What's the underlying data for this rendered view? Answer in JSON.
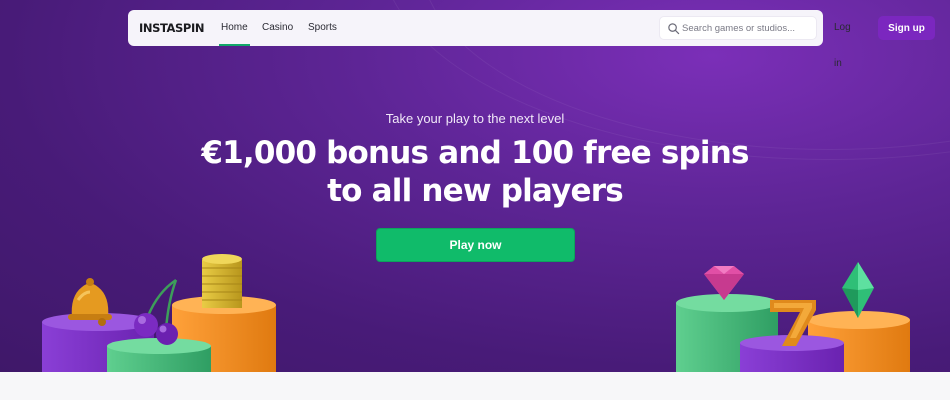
{
  "brand": {
    "logo_text": "INSTASPIN"
  },
  "nav": {
    "links": [
      {
        "label": "Home",
        "active": true
      },
      {
        "label": "Casino",
        "active": false
      },
      {
        "label": "Sports",
        "active": false
      }
    ],
    "search": {
      "placeholder": "Search games or studios...",
      "value": "",
      "icon": "search-icon"
    },
    "login_label": "Log in",
    "signup_label": "Sign up"
  },
  "hero": {
    "tagline": "Take your play to the next level",
    "headline": "€1,000 bonus and 100 free spins to all new players",
    "cta_label": "Play now",
    "decor_icons": [
      "bell-icon",
      "cherries-icon",
      "coin-stack-icon",
      "gem-icon",
      "lucky-seven-icon",
      "diamond-crystal-icon"
    ]
  },
  "colors": {
    "hero_bg": "#5e2596",
    "accent_purple": "#7b27bf",
    "cta_green": "#10bb6a",
    "active_underline": "#13a86a"
  }
}
